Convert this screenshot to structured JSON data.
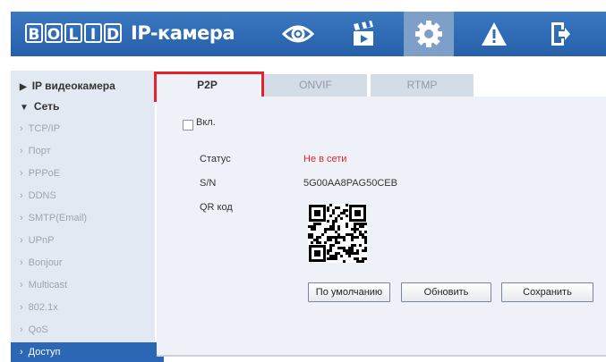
{
  "header": {
    "logo_letters": [
      "B",
      "O",
      "L",
      "I",
      "D"
    ],
    "logo_text": "BOLID",
    "title": "IP-камера",
    "nav_icons": [
      {
        "name": "live-view-eye-icon"
      },
      {
        "name": "playback-clapper-icon"
      },
      {
        "name": "settings-gear-icon",
        "active": true
      },
      {
        "name": "alarm-warning-icon"
      },
      {
        "name": "logout-icon"
      }
    ]
  },
  "sidebar": {
    "groups": [
      {
        "label": "IP видеокамера",
        "expanded": false
      },
      {
        "label": "Сеть",
        "expanded": true
      }
    ],
    "items": [
      "TCP/IP",
      "Порт",
      "PPPoE",
      "DDNS",
      "SMTP(Email)",
      "UPnP",
      "Bonjour",
      "Multicast",
      "802.1x",
      "QoS",
      "Доступ"
    ],
    "selected": "Доступ"
  },
  "tabs": [
    {
      "label": "P2P",
      "active": true
    },
    {
      "label": "ONVIF",
      "active": false
    },
    {
      "label": "RTMP",
      "active": false
    }
  ],
  "p2p": {
    "enable_label": "Вкл.",
    "enabled": false,
    "status_label": "Статус",
    "status_value": "Не в сети",
    "sn_label": "S/N",
    "sn_value": "5G00AA8PAG50CEB",
    "qr_label": "QR код"
  },
  "buttons": {
    "default": "По умолчанию",
    "refresh": "Обновить",
    "save": "Сохранить"
  },
  "colors": {
    "header": "#2f6cb6",
    "selected_item": "#2b67b5",
    "highlight": "#e8202a",
    "offline_status": "#e8202a"
  }
}
